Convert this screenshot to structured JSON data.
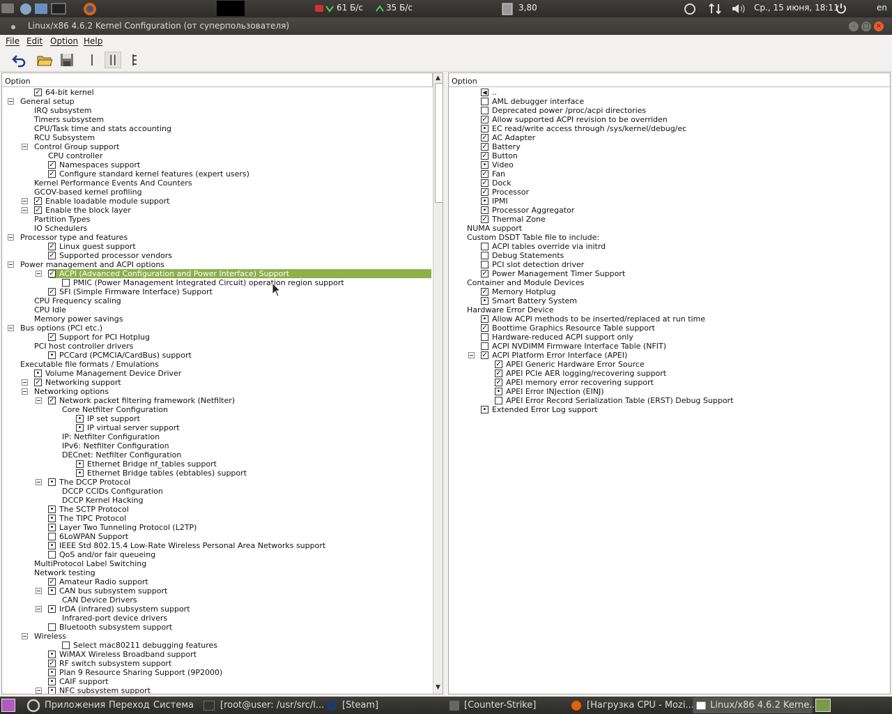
{
  "top_panel": {
    "net_down": "61 Б/с",
    "net_up": "35 Б/с",
    "cpu_load": "3,80",
    "datetime": "Ср., 15 июня, 18:11",
    "layout": "en",
    "icons": [
      "steam-icon",
      "network-icon",
      "volume-icon",
      "power-icon"
    ]
  },
  "window": {
    "title": "Linux/x86 4.6.2 Kernel Configuration (от суперпользователя)"
  },
  "menu": [
    "File",
    "Edit",
    "Option",
    "Help"
  ],
  "toolbar": {
    "buttons": [
      "back-icon",
      "open-folder-icon",
      "save-icon",
      "single-view-icon",
      "split-view-icon",
      "full-view-icon"
    ]
  },
  "left_pane": {
    "header": "Option",
    "rows": [
      {
        "label": "64-bit kernel",
        "check": "checked"
      },
      {
        "label": "General setup",
        "expanded": true
      },
      {
        "label": "IRQ subsystem"
      },
      {
        "label": "Timers subsystem"
      },
      {
        "label": "CPU/Task time and stats accounting"
      },
      {
        "label": "RCU Subsystem"
      },
      {
        "label": "Control Group support",
        "expanded": true
      },
      {
        "label": "CPU controller"
      },
      {
        "label": "Namespaces support",
        "check": "checked"
      },
      {
        "label": "Configure standard kernel features (expert users)",
        "check": "checked"
      },
      {
        "label": "Kernel Performance Events And Counters"
      },
      {
        "label": "GCOV-based kernel profiling"
      },
      {
        "label": "Enable loadable module support",
        "check": "checked",
        "expanded": true
      },
      {
        "label": "Enable the block layer",
        "check": "checked",
        "expanded": true
      },
      {
        "label": "Partition Types"
      },
      {
        "label": "IO Schedulers"
      },
      {
        "label": "Processor type and features",
        "expanded": true
      },
      {
        "label": "Linux guest support",
        "check": "checked"
      },
      {
        "label": "Supported processor vendors",
        "check": "checked"
      },
      {
        "label": "Power management and ACPI options",
        "expanded": true
      },
      {
        "label": "ACPI (Advanced Configuration and Power Interface) Support",
        "check": "checked",
        "expanded": true,
        "highlight": true
      },
      {
        "label": "PMIC (Power Management Integrated Circuit) operation region support",
        "check": "unchecked"
      },
      {
        "label": "SFI (Simple Firmware Interface) Support",
        "check": "checked"
      },
      {
        "label": "CPU Frequency scaling"
      },
      {
        "label": "CPU Idle"
      },
      {
        "label": "Memory power savings"
      },
      {
        "label": "Bus options (PCI etc.)",
        "expanded": true
      },
      {
        "label": "Support for PCI Hotplug",
        "check": "checked"
      },
      {
        "label": "PCI host controller drivers"
      },
      {
        "label": "PCCard (PCMCIA/CardBus) support",
        "check": "module"
      },
      {
        "label": "Executable file formats / Emulations"
      },
      {
        "label": "Volume Management Device Driver",
        "check": "module"
      },
      {
        "label": "Networking support",
        "check": "checked",
        "expanded": true
      },
      {
        "label": "Networking options",
        "expanded": true
      },
      {
        "label": "Network packet filtering framework (Netfilter)",
        "check": "checked",
        "expanded": true
      },
      {
        "label": "Core Netfilter Configuration"
      },
      {
        "label": "IP set support",
        "check": "module"
      },
      {
        "label": "IP virtual server support",
        "check": "module"
      },
      {
        "label": "IP: Netfilter Configuration"
      },
      {
        "label": "IPv6: Netfilter Configuration"
      },
      {
        "label": "DECnet: Netfilter Configuration"
      },
      {
        "label": "Ethernet Bridge nf_tables support",
        "check": "module"
      },
      {
        "label": "Ethernet Bridge tables (ebtables) support",
        "check": "module"
      },
      {
        "label": "The DCCP Protocol",
        "check": "module",
        "expanded": true
      },
      {
        "label": "DCCP CCIDs Configuration"
      },
      {
        "label": "DCCP Kernel Hacking"
      },
      {
        "label": "The SCTP Protocol",
        "check": "module"
      },
      {
        "label": "The TIPC Protocol",
        "check": "module"
      },
      {
        "label": "Layer Two Tunneling Protocol (L2TP)",
        "check": "module"
      },
      {
        "label": "6LoWPAN Support",
        "check": "unchecked"
      },
      {
        "label": "IEEE Std 802.15.4 Low-Rate Wireless Personal Area Networks support",
        "check": "module"
      },
      {
        "label": "QoS and/or fair queueing",
        "check": "unchecked"
      },
      {
        "label": "MultiProtocol Label Switching"
      },
      {
        "label": "Network testing"
      },
      {
        "label": "Amateur Radio support",
        "check": "checked"
      },
      {
        "label": "CAN bus subsystem support",
        "check": "module",
        "expanded": true
      },
      {
        "label": "CAN Device Drivers"
      },
      {
        "label": "IrDA (infrared) subsystem support",
        "check": "module",
        "expanded": true
      },
      {
        "label": "Infrared-port device drivers"
      },
      {
        "label": "Bluetooth subsystem support",
        "check": "unchecked"
      },
      {
        "label": "Wireless",
        "expanded": true
      },
      {
        "label": "Select mac80211 debugging features",
        "check": "unchecked"
      },
      {
        "label": "WiMAX Wireless Broadband support",
        "check": "module"
      },
      {
        "label": "RF switch subsystem support",
        "check": "checked"
      },
      {
        "label": "Plan 9 Resource Sharing Support (9P2000)",
        "check": "module"
      },
      {
        "label": "CAIF support",
        "check": "module"
      },
      {
        "label": "NFC subsystem support",
        "check": "module",
        "expanded": true
      }
    ]
  },
  "right_pane": {
    "header": "Option",
    "rows": [
      {
        "label": "..",
        "check": "back"
      },
      {
        "label": "AML debugger interface",
        "check": "unchecked"
      },
      {
        "label": "Deprecated power /proc/acpi directories",
        "check": "unchecked"
      },
      {
        "label": "Allow supported ACPI revision to be overriden",
        "check": "checked"
      },
      {
        "label": "EC read/write access through /sys/kernel/debug/ec",
        "check": "module"
      },
      {
        "label": "AC Adapter",
        "check": "checked"
      },
      {
        "label": "Battery",
        "check": "checked"
      },
      {
        "label": "Button",
        "check": "checked"
      },
      {
        "label": "Video",
        "check": "module"
      },
      {
        "label": "Fan",
        "check": "checked"
      },
      {
        "label": "Dock",
        "check": "checked"
      },
      {
        "label": "Processor",
        "check": "checked"
      },
      {
        "label": "IPMI",
        "check": "module"
      },
      {
        "label": "Processor Aggregator",
        "check": "module"
      },
      {
        "label": "Thermal Zone",
        "check": "checked"
      },
      {
        "label": "NUMA support"
      },
      {
        "label": "Custom DSDT Table file to include:"
      },
      {
        "label": "ACPI tables override via initrd",
        "check": "unchecked"
      },
      {
        "label": "Debug Statements",
        "check": "unchecked"
      },
      {
        "label": "PCI slot detection driver",
        "check": "unchecked"
      },
      {
        "label": "Power Management Timer Support",
        "check": "checked"
      },
      {
        "label": "Container and Module Devices"
      },
      {
        "label": "Memory Hotplug",
        "check": "checked"
      },
      {
        "label": "Smart Battery System",
        "check": "module"
      },
      {
        "label": "Hardware Error Device"
      },
      {
        "label": "Allow ACPI methods to be inserted/replaced at run time",
        "check": "module"
      },
      {
        "label": "Boottime Graphics Resource Table support",
        "check": "checked"
      },
      {
        "label": "Hardware-reduced ACPI support only",
        "check": "unchecked"
      },
      {
        "label": "ACPI NVDIMM Firmware Interface Table (NFIT)",
        "check": "unchecked"
      },
      {
        "label": "ACPI Platform Error Interface (APEI)",
        "check": "checked",
        "expanded": true
      },
      {
        "label": "APEI Generic Hardware Error Source",
        "check": "checked"
      },
      {
        "label": "APEI PCIe AER logging/recovering support",
        "check": "checked"
      },
      {
        "label": "APEI memory error recovering support",
        "check": "checked"
      },
      {
        "label": "APEI Error INJection (EINJ)",
        "check": "module"
      },
      {
        "label": "APEI Error Record Serialization Table (ERST) Debug Support",
        "check": "unchecked"
      },
      {
        "label": "Extended Error Log support",
        "check": "module"
      }
    ]
  },
  "taskbar": {
    "menus": [
      "Приложения",
      "Переход",
      "Система"
    ],
    "tasks": [
      "[root@user: /usr/src/l...",
      "[Steam]",
      "[Counter-Strike]",
      "[Нагрузка CPU - Mozi...",
      "Linux/x86 4.6.2 Kerne..."
    ]
  },
  "colors": {
    "highlight": "#8cb04a",
    "panel": "#3a3935",
    "close_button": "#ef5b2a"
  }
}
